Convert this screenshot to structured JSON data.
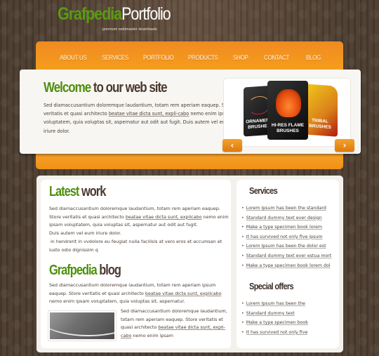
{
  "header": {
    "logo_green": "Grafpedia",
    "logo_white": "Portfolio",
    "tagline": "premium webmaster downloads"
  },
  "nav": {
    "items": [
      "ABOUT US",
      "SERVICES",
      "PORTFOLIO",
      "PRODUCTS",
      "SHOP",
      "CONTACT",
      "BLOG"
    ]
  },
  "hero": {
    "title_green": "Welcome",
    "title_rest": "to our web site",
    "text_before": "Sed diamaccusantium doloremque laudantium, totam rem aperiam eaquep. Store veritatis et quasi architecto ",
    "text_link": "beatae vitae dicta sunt, expli-cabo",
    "text_after": " nemo enim ipsam voluptatem, quia voluptas sit, aspernatur aut odit aut fugit. Duis autem vel eum iriure dolor.",
    "slider": {
      "products": [
        {
          "name": "ORNAMENT BRUSHES",
          "label1": "ORNAMENT",
          "label2": "BRUSHES"
        },
        {
          "name": "HI-RES FLAME BRUSHES",
          "label1": "HI-RES FLAME",
          "label2": "BRUSHES"
        },
        {
          "name": "TRIBAL BRUSHES",
          "label1": "TRIBAL",
          "label2": "BRUSHES"
        }
      ],
      "prev_icon": "‹",
      "next_icon": "›"
    }
  },
  "latest": {
    "title_green": "Latest",
    "title_rest": "work",
    "line1": "Sed diamaccusantium doloremque laudantium, totam rem aperiam eaquep.",
    "line2_before": "Store veritatis et quasi architecto ",
    "line2_link": "beatae vitae dicta sunt, explicabo",
    "line2_after": " nemo enim",
    "line3": "ipsam voluptatem, quia voluptas sit, aspernatur aut odit aut fugit.",
    "line4": "Duis autem vel eum iriure dolor.",
    "line5": " in hendrerit in vvdolore eu feugiat nulla facilisis at vero eros et accumsan et",
    "line6": "iusto odio dignissim q"
  },
  "blog": {
    "title_green": "Grafpedia",
    "title_rest": "blog",
    "p1_before": "Sed diamaccusantium doloremque laudantium, totam rem aperiam ipsum eaquep. Store veritatis et quasi architecto ",
    "p1_link": "beatae vitae dicta sunt, explicabo",
    "p1_after": " nemo enim ipsam voluptatem, quia voluptas sit, aspernatur.",
    "p2_before": "Sed diamaccusantium doloremque laudantium, totam rem aperiam eaquep. Store veritatis et quasi architecto ",
    "p2_link": "beatae vitae dicta sunt, expli-cabo",
    "p2_after": " nemo enim ipsam"
  },
  "services": {
    "title": "Services",
    "items": [
      "Lorem Ipsum has been the standard",
      "Standard dummy text ever design",
      "Make a type specimen book lorem",
      "It has survived not only five ipsum",
      "Lorem Ipsum has been the dolor est",
      "Standard dummy text ever estua mort",
      "Make a type specimen book lorem dol"
    ]
  },
  "offers": {
    "title": "Special offers",
    "items": [
      "Lorem Ipsum has been the ",
      "Standard dummy text ",
      "Make a type specimen book",
      "It has survived not only five"
    ]
  }
}
